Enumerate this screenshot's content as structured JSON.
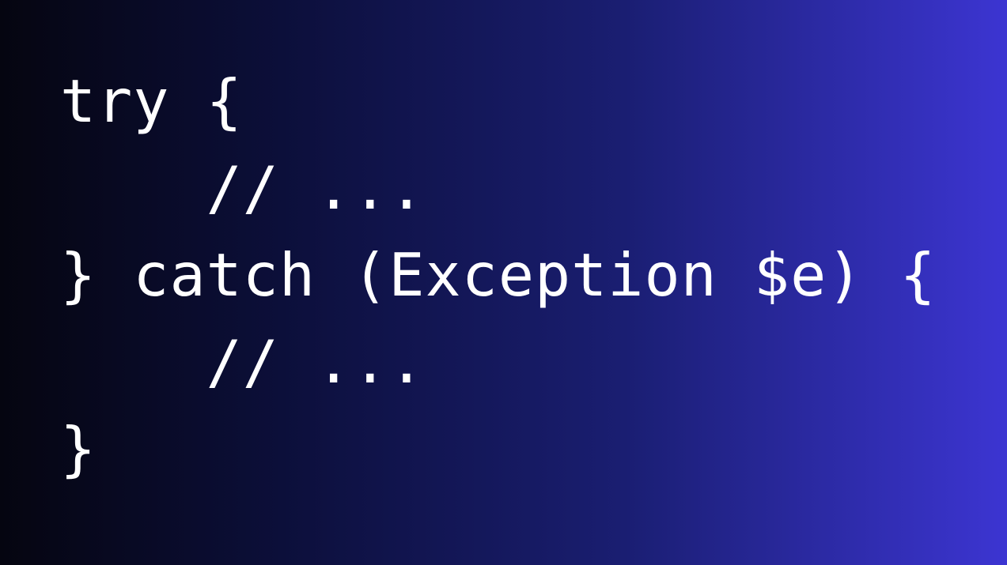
{
  "code": {
    "lines": [
      "try {",
      "    // ...",
      "} catch (Exception $e) {",
      "    // ...",
      "}"
    ]
  },
  "colors": {
    "text": "#ffffff",
    "background_left": "#050510",
    "background_right": "#3c35d2"
  }
}
